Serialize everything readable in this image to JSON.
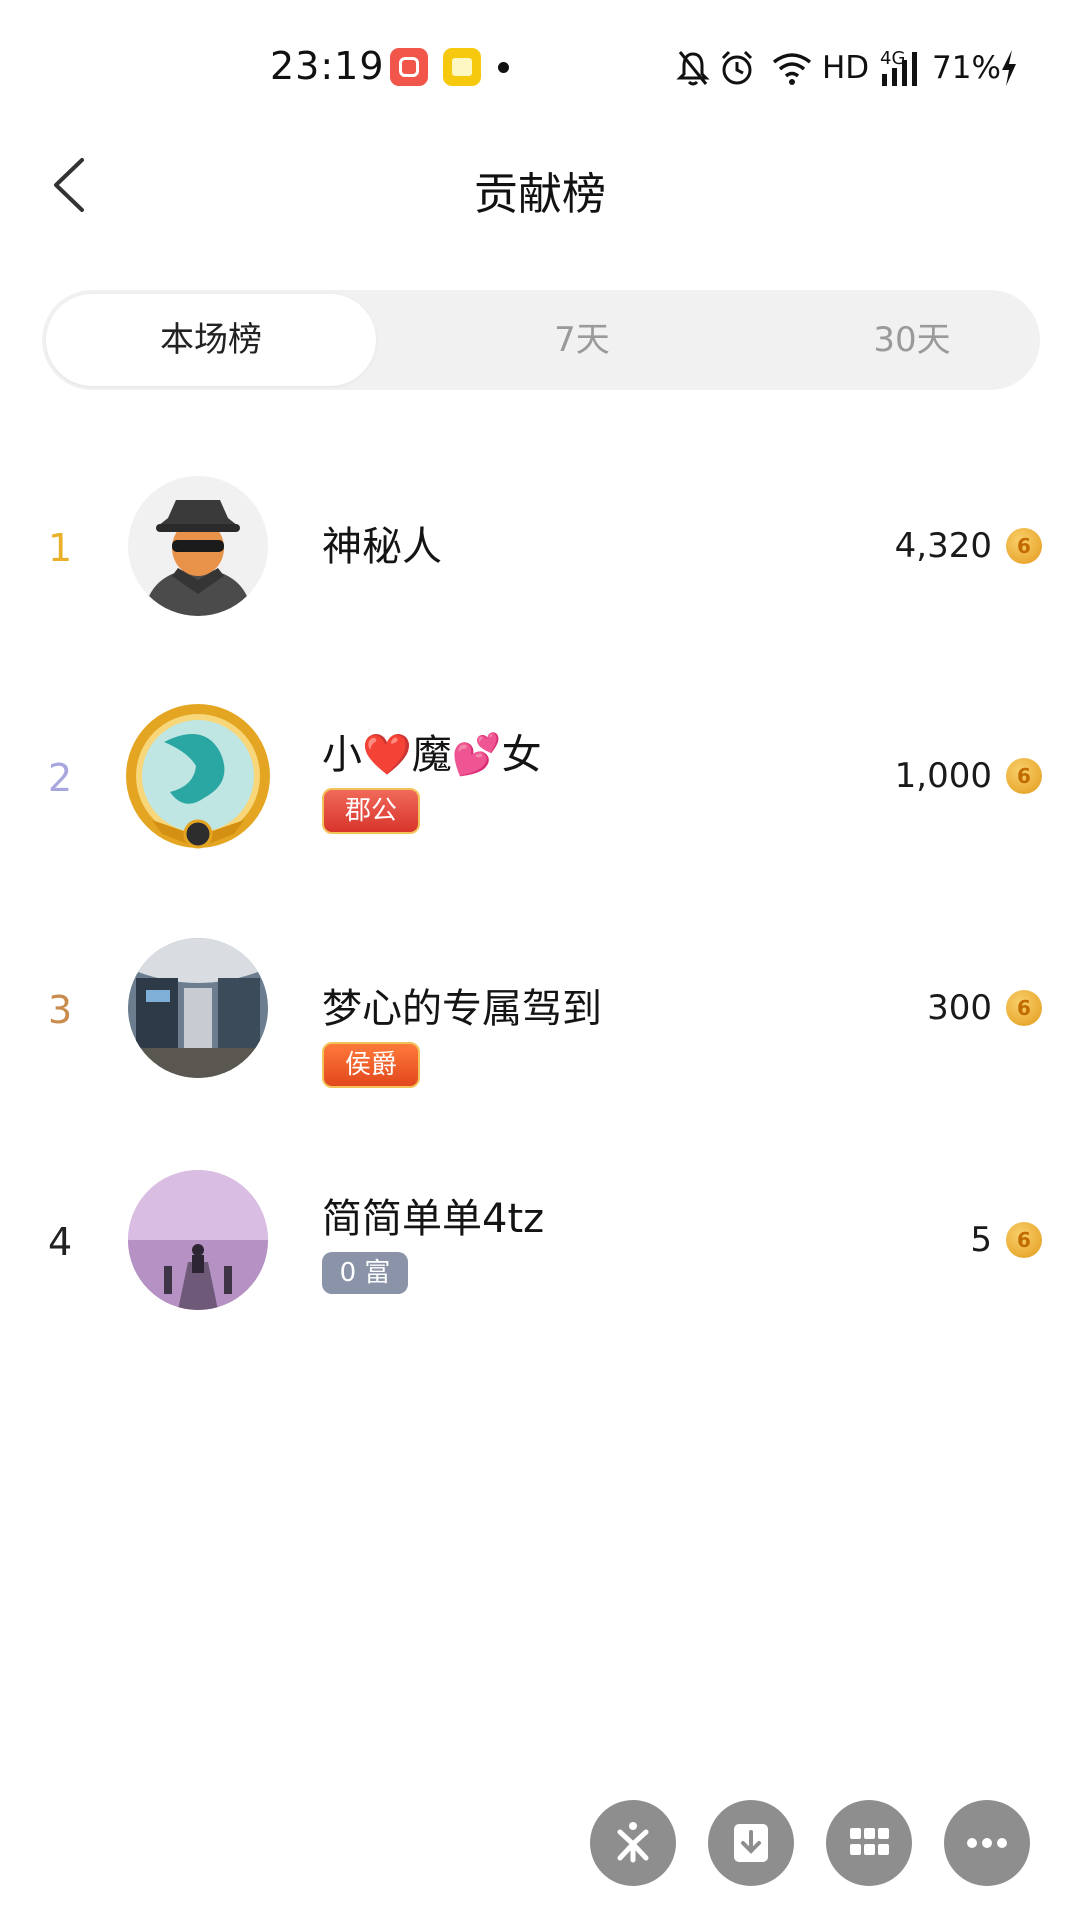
{
  "status_bar": {
    "time": "23:19",
    "network": "HD",
    "signal_label": "4G",
    "battery": "71%"
  },
  "header": {
    "title": "贡献榜",
    "back_icon": "chevron-left-icon"
  },
  "tabs": [
    {
      "label": "本场榜",
      "active": true
    },
    {
      "label": "7天",
      "active": false
    },
    {
      "label": "30天",
      "active": false
    }
  ],
  "leaderboard": [
    {
      "rank": "1",
      "name": "神秘人",
      "badge": "",
      "score": "4,320",
      "rank_color": "#e9b12a"
    },
    {
      "rank": "2",
      "name": "小❤️魔💕女",
      "badge": "郡公",
      "score": "1,000",
      "rank_color": "#a7a6dd"
    },
    {
      "rank": "3",
      "name": "梦心的专属驾到",
      "badge": "侯爵",
      "score": "300",
      "rank_color": "#c98c4d"
    },
    {
      "rank": "4",
      "name": "简简单单4tz",
      "badge": "0 富",
      "score": "5",
      "rank_color": "#222222"
    }
  ],
  "coin_glyph": "6",
  "bottom_actions": [
    "share-icon",
    "download-icon",
    "grid-icon",
    "more-icon"
  ]
}
